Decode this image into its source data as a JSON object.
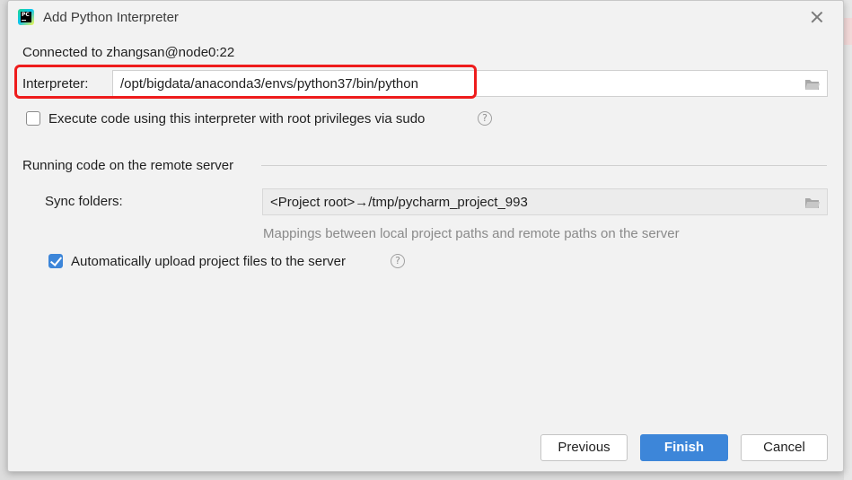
{
  "dialog": {
    "title": "Add Python Interpreter",
    "connected_text": "Connected to zhangsan@node0:22",
    "app_icon_text": "PC"
  },
  "interpreter": {
    "label": "Interpreter:",
    "value": "/opt/bigdata/anaconda3/envs/python37/bin/python"
  },
  "sudo_option": {
    "label": "Execute code using this interpreter with root privileges via sudo",
    "checked": false
  },
  "remote_section": {
    "title": "Running code on the remote server",
    "sync_label": "Sync folders:",
    "sync_value": "<Project root>→/tmp/pycharm_project_993",
    "hint": "Mappings between local project paths and remote paths on the server",
    "auto_upload_label": "Automatically upload project files to the server",
    "auto_upload_checked": true
  },
  "buttons": {
    "previous": "Previous",
    "finish": "Finish",
    "cancel": "Cancel"
  },
  "icons": {
    "help": "?",
    "app": "pycharm-icon",
    "close": "close-icon",
    "folder": "folder-icon"
  },
  "colors": {
    "accent": "#3d86d9",
    "highlight": "#ee1c1c"
  }
}
